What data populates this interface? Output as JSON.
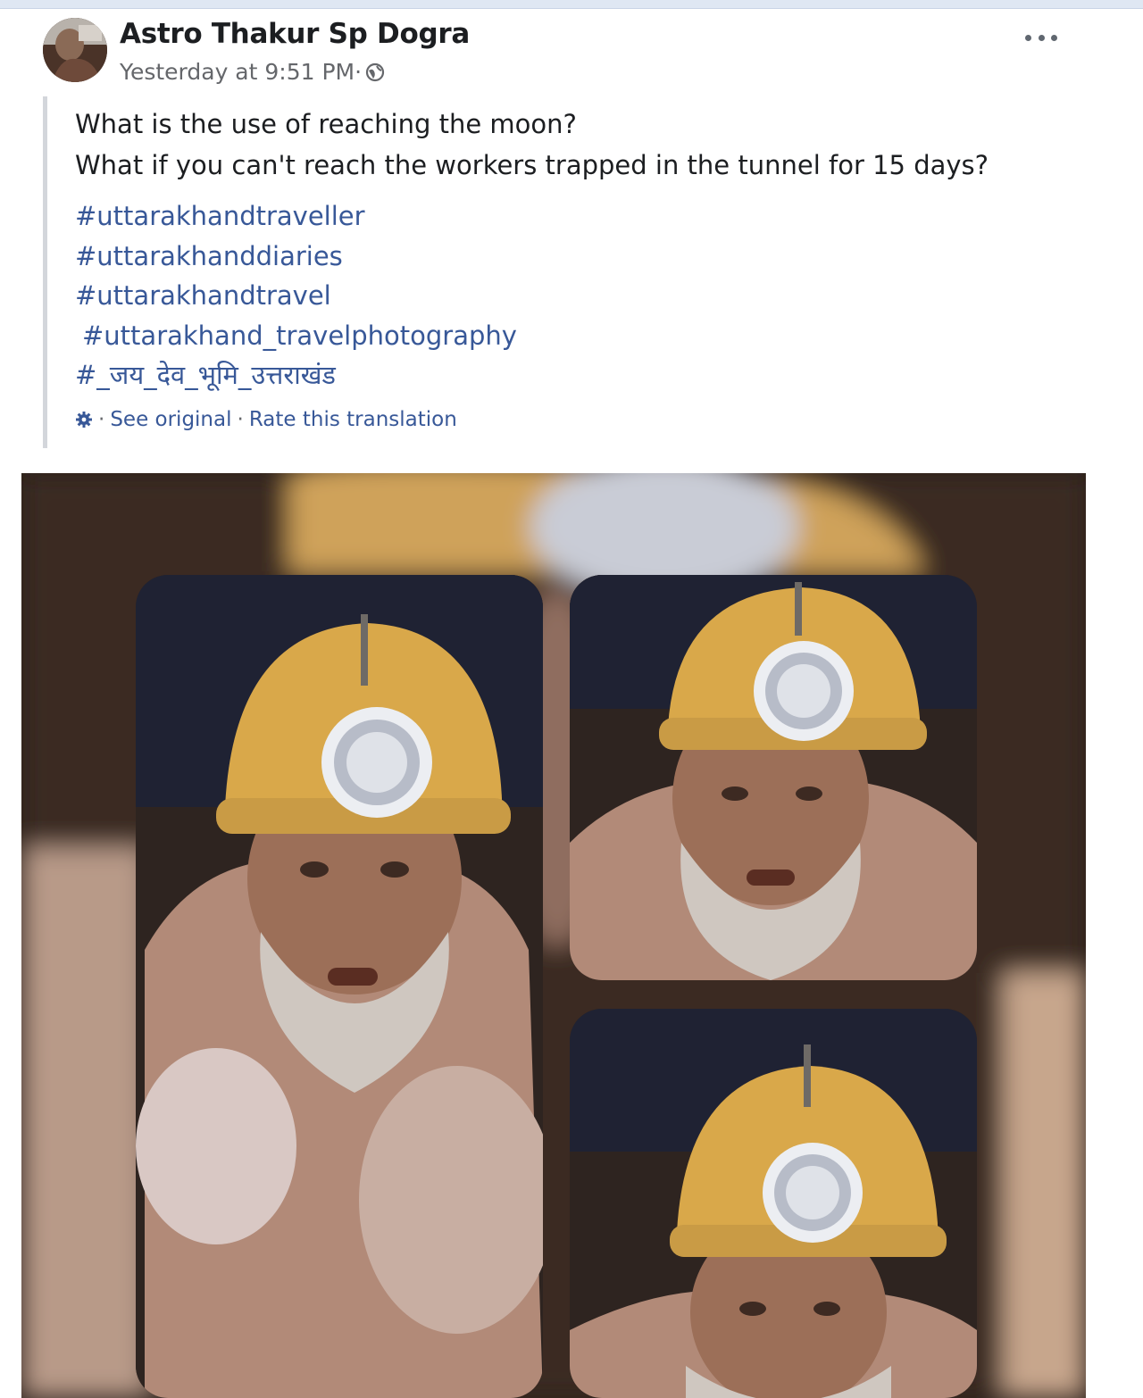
{
  "post": {
    "author": "Astro Thakur Sp Dogra",
    "timestamp": "Yesterday at 9:51 PM",
    "separator": " · ",
    "lines": [
      "What is the use of reaching the moon?",
      "What if you can't reach the workers trapped in the tunnel for 15 days?"
    ],
    "hashtags": [
      "#uttarakhandtraveller",
      "#uttarakhanddiaries",
      "#uttarakhandtravel",
      "#uttarakhand_travelphotography",
      "#_जय_देव_भूमि_उत्तराखंड"
    ],
    "translation": {
      "see_original": "See original",
      "rate": "Rate this translation",
      "dot": "·"
    }
  },
  "icons": {
    "privacy": "globe-icon",
    "menu": "more-options-icon",
    "translation": "gear-icon"
  },
  "colors": {
    "link": "#385898",
    "text": "#1c1e21",
    "muted": "#65676b",
    "helmet": "#d9a84a"
  }
}
